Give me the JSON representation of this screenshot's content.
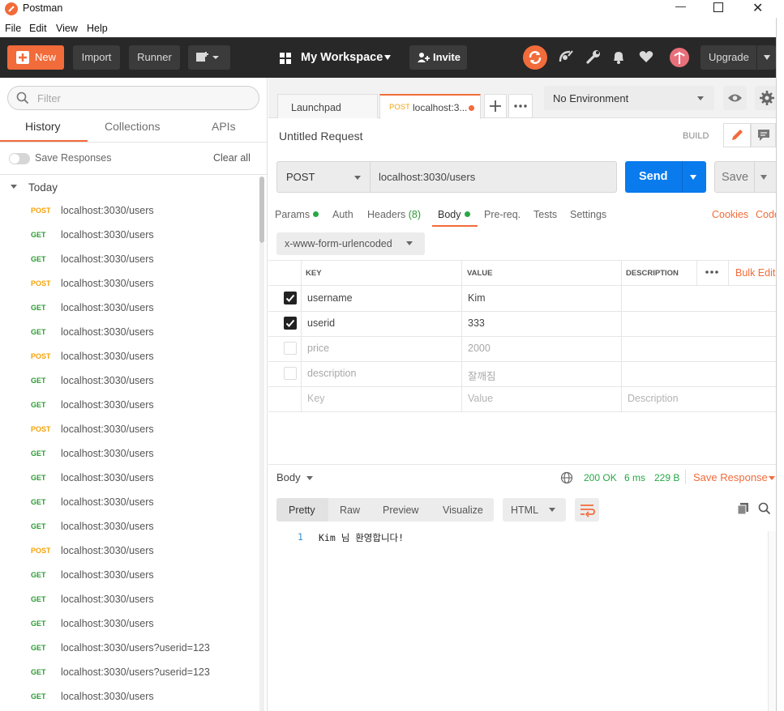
{
  "window": {
    "title": "Postman",
    "minimize": "—",
    "maximize": "☐",
    "close": "✕"
  },
  "menu": [
    "File",
    "Edit",
    "View",
    "Help"
  ],
  "toolbar": {
    "new_label": "New",
    "import_label": "Import",
    "runner_label": "Runner",
    "workspace_label": "My Workspace",
    "invite_label": "Invite",
    "upgrade_label": "Upgrade"
  },
  "sidebar": {
    "filter_placeholder": "Filter",
    "tabs": [
      "History",
      "Collections",
      "APIs"
    ],
    "active_tab": "History",
    "save_responses_label": "Save Responses",
    "clear_all_label": "Clear all",
    "group_label": "Today",
    "history": [
      {
        "method": "POST",
        "url": "localhost:3030/users"
      },
      {
        "method": "GET",
        "url": "localhost:3030/users"
      },
      {
        "method": "GET",
        "url": "localhost:3030/users"
      },
      {
        "method": "POST",
        "url": "localhost:3030/users"
      },
      {
        "method": "GET",
        "url": "localhost:3030/users"
      },
      {
        "method": "GET",
        "url": "localhost:3030/users"
      },
      {
        "method": "POST",
        "url": "localhost:3030/users"
      },
      {
        "method": "GET",
        "url": "localhost:3030/users"
      },
      {
        "method": "GET",
        "url": "localhost:3030/users"
      },
      {
        "method": "POST",
        "url": "localhost:3030/users"
      },
      {
        "method": "GET",
        "url": "localhost:3030/users"
      },
      {
        "method": "GET",
        "url": "localhost:3030/users"
      },
      {
        "method": "GET",
        "url": "localhost:3030/users"
      },
      {
        "method": "GET",
        "url": "localhost:3030/users"
      },
      {
        "method": "POST",
        "url": "localhost:3030/users"
      },
      {
        "method": "GET",
        "url": "localhost:3030/users"
      },
      {
        "method": "GET",
        "url": "localhost:3030/users"
      },
      {
        "method": "GET",
        "url": "localhost:3030/users"
      },
      {
        "method": "GET",
        "url": "localhost:3030/users?userid=123"
      },
      {
        "method": "GET",
        "url": "localhost:3030/users?userid=123"
      },
      {
        "method": "GET",
        "url": "localhost:3030/users"
      }
    ]
  },
  "tabs": {
    "launchpad_label": "Launchpad",
    "active_method": "POST",
    "active_label": "localhost:3...",
    "environment": "No Environment"
  },
  "request": {
    "name": "Untitled Request",
    "build_label": "BUILD",
    "method": "POST",
    "url": "localhost:3030/users",
    "send_label": "Send",
    "save_label": "Save",
    "subtabs": {
      "params": "Params",
      "auth": "Auth",
      "headers": "Headers",
      "headers_count": "(8)",
      "body": "Body",
      "prereq": "Pre-req.",
      "tests": "Tests",
      "settings": "Settings",
      "cookies": "Cookies",
      "code": "Code"
    },
    "body_type": "x-www-form-urlencoded",
    "table_headers": {
      "key": "KEY",
      "value": "VALUE",
      "description": "DESCRIPTION",
      "bulk_edit": "Bulk Edit"
    },
    "rows": [
      {
        "checked": true,
        "key": "username",
        "value": "Kim"
      },
      {
        "checked": true,
        "key": "userid",
        "value": "333"
      },
      {
        "checked": false,
        "key": "price",
        "value": "2000"
      },
      {
        "checked": false,
        "key": "description",
        "value": "잘깨짐"
      }
    ],
    "placeholders": {
      "key": "Key",
      "value": "Value",
      "description": "Description"
    }
  },
  "response": {
    "body_label": "Body",
    "status": "200 OK",
    "time": "6 ms",
    "size": "229 B",
    "save_response_label": "Save Response",
    "view_tabs": [
      "Pretty",
      "Raw",
      "Preview",
      "Visualize"
    ],
    "format": "HTML",
    "line_number": "1",
    "content": "Kim 님 환영합니다!"
  },
  "colors": {
    "accent": "#f26b3a",
    "send_blue": "#097bed",
    "post": "#f4a30a",
    "get": "#2d9b34",
    "status_green": "#27a745"
  }
}
